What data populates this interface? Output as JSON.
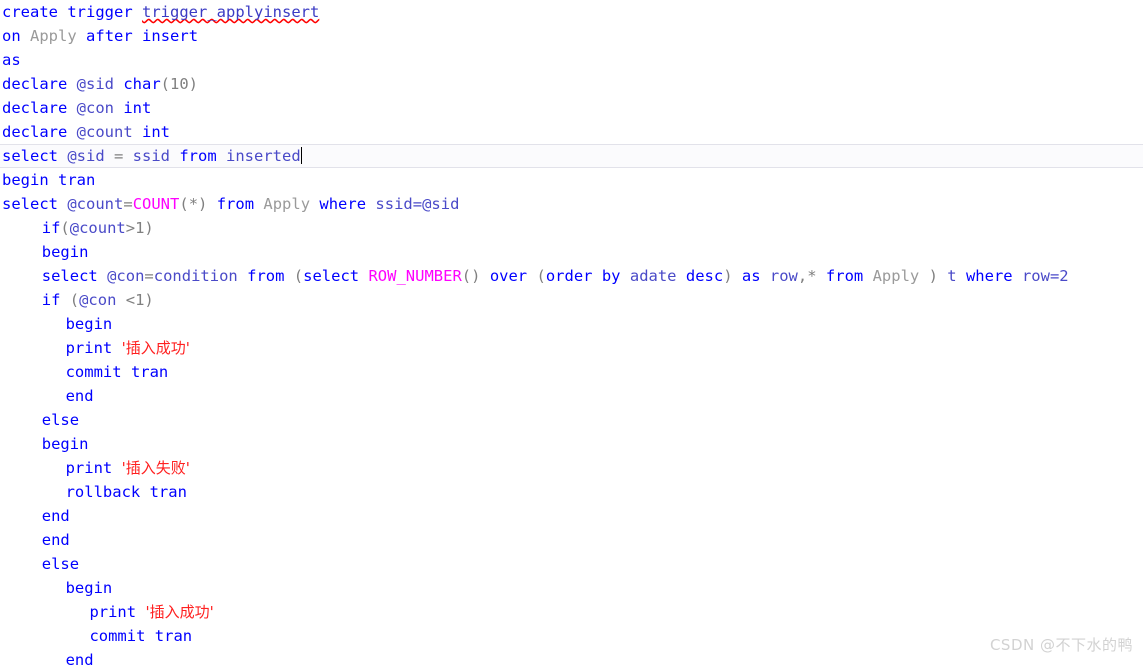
{
  "editor": {
    "language": "sql",
    "cursor_line_index": 7,
    "colors": {
      "background": "#ffffff",
      "keyword": "#0000ff",
      "function": "#ff00ff",
      "identifier": "#9a9a9a",
      "string": "#ff2020",
      "variable": "#4a4ac8",
      "current_line_border": "#e2e2ea",
      "spellcheck_underline": "#ff0000",
      "watermark": "#d2d2d2"
    },
    "lines": [
      {
        "indent": 0,
        "current": false,
        "tokens": [
          {
            "t": "create",
            "c": "kw"
          },
          {
            "t": " ",
            "c": "pl"
          },
          {
            "t": "trigger",
            "c": "kw"
          },
          {
            "t": " ",
            "c": "pl"
          },
          {
            "t": "trigger_applyinsert",
            "c": "squiggle"
          }
        ]
      },
      {
        "indent": 0,
        "current": false,
        "tokens": [
          {
            "t": "on",
            "c": "kw"
          },
          {
            "t": " ",
            "c": "pl"
          },
          {
            "t": "Apply",
            "c": "id"
          },
          {
            "t": " ",
            "c": "pl"
          },
          {
            "t": "after",
            "c": "kw"
          },
          {
            "t": " ",
            "c": "pl"
          },
          {
            "t": "insert",
            "c": "kw"
          }
        ]
      },
      {
        "indent": 0,
        "current": false,
        "tokens": [
          {
            "t": "as",
            "c": "kw"
          }
        ]
      },
      {
        "indent": 0,
        "current": false,
        "tokens": [
          {
            "t": "declare",
            "c": "kw"
          },
          {
            "t": " ",
            "c": "pl"
          },
          {
            "t": "@sid",
            "c": "var"
          },
          {
            "t": " ",
            "c": "pl"
          },
          {
            "t": "char",
            "c": "kw"
          },
          {
            "t": "(10)",
            "c": "pl"
          }
        ]
      },
      {
        "indent": 0,
        "current": false,
        "tokens": [
          {
            "t": "declare",
            "c": "kw"
          },
          {
            "t": " ",
            "c": "pl"
          },
          {
            "t": "@con",
            "c": "var"
          },
          {
            "t": " ",
            "c": "pl"
          },
          {
            "t": "int",
            "c": "kw"
          }
        ]
      },
      {
        "indent": 0,
        "current": false,
        "tokens": [
          {
            "t": "declare",
            "c": "kw"
          },
          {
            "t": " ",
            "c": "pl"
          },
          {
            "t": "@count",
            "c": "var"
          },
          {
            "t": " ",
            "c": "pl"
          },
          {
            "t": "int",
            "c": "kw"
          }
        ]
      },
      {
        "indent": 0,
        "current": true,
        "caret": true,
        "tokens": [
          {
            "t": "select",
            "c": "kw"
          },
          {
            "t": " ",
            "c": "pl"
          },
          {
            "t": "@sid",
            "c": "var"
          },
          {
            "t": " = ",
            "c": "pl"
          },
          {
            "t": "ssid",
            "c": "var"
          },
          {
            "t": " ",
            "c": "pl"
          },
          {
            "t": "from",
            "c": "kw"
          },
          {
            "t": " ",
            "c": "pl"
          },
          {
            "t": "inserted",
            "c": "var"
          }
        ]
      },
      {
        "indent": 0,
        "current": false,
        "tokens": [
          {
            "t": "begin",
            "c": "kw"
          },
          {
            "t": " ",
            "c": "pl"
          },
          {
            "t": "tran",
            "c": "kw"
          }
        ]
      },
      {
        "indent": 0,
        "current": false,
        "tokens": [
          {
            "t": "select",
            "c": "kw"
          },
          {
            "t": " ",
            "c": "pl"
          },
          {
            "t": "@count",
            "c": "var"
          },
          {
            "t": "=",
            "c": "pl"
          },
          {
            "t": "COUNT",
            "c": "fn"
          },
          {
            "t": "(*)",
            "c": "pl"
          },
          {
            "t": " ",
            "c": "pl"
          },
          {
            "t": "from",
            "c": "kw"
          },
          {
            "t": " ",
            "c": "pl"
          },
          {
            "t": "Apply",
            "c": "id"
          },
          {
            "t": " ",
            "c": "pl"
          },
          {
            "t": "where",
            "c": "kw"
          },
          {
            "t": " ",
            "c": "pl"
          },
          {
            "t": "ssid=",
            "c": "var"
          },
          {
            "t": "@sid",
            "c": "var"
          }
        ]
      },
      {
        "indent": 5,
        "current": false,
        "tokens": [
          {
            "t": "if",
            "c": "kw"
          },
          {
            "t": "(",
            "c": "pl"
          },
          {
            "t": "@count",
            "c": "var"
          },
          {
            "t": ">1)",
            "c": "pl"
          }
        ]
      },
      {
        "indent": 5,
        "current": false,
        "tokens": [
          {
            "t": "begin",
            "c": "kw"
          }
        ]
      },
      {
        "indent": 5,
        "current": false,
        "tokens": [
          {
            "t": "select",
            "c": "kw"
          },
          {
            "t": " ",
            "c": "pl"
          },
          {
            "t": "@con",
            "c": "var"
          },
          {
            "t": "=",
            "c": "pl"
          },
          {
            "t": "condition",
            "c": "var"
          },
          {
            "t": " ",
            "c": "pl"
          },
          {
            "t": "from",
            "c": "kw"
          },
          {
            "t": " ",
            "c": "pl"
          },
          {
            "t": "(",
            "c": "pl"
          },
          {
            "t": "select",
            "c": "kw"
          },
          {
            "t": " ",
            "c": "pl"
          },
          {
            "t": "ROW_NUMBER",
            "c": "fn"
          },
          {
            "t": "()",
            "c": "pl"
          },
          {
            "t": " ",
            "c": "pl"
          },
          {
            "t": "over",
            "c": "kw"
          },
          {
            "t": " ",
            "c": "pl"
          },
          {
            "t": "(",
            "c": "pl"
          },
          {
            "t": "order",
            "c": "kw"
          },
          {
            "t": " ",
            "c": "pl"
          },
          {
            "t": "by",
            "c": "kw"
          },
          {
            "t": " ",
            "c": "pl"
          },
          {
            "t": "adate",
            "c": "var"
          },
          {
            "t": " ",
            "c": "pl"
          },
          {
            "t": "desc",
            "c": "kw"
          },
          {
            "t": ") ",
            "c": "pl"
          },
          {
            "t": "as",
            "c": "kw"
          },
          {
            "t": " ",
            "c": "pl"
          },
          {
            "t": "row",
            "c": "var"
          },
          {
            "t": ",",
            "c": "pl"
          },
          {
            "t": "*",
            "c": "pl"
          },
          {
            "t": " ",
            "c": "pl"
          },
          {
            "t": "from",
            "c": "kw"
          },
          {
            "t": " ",
            "c": "pl"
          },
          {
            "t": "Apply",
            "c": "id"
          },
          {
            "t": " ) ",
            "c": "pl"
          },
          {
            "t": "t",
            "c": "var"
          },
          {
            "t": " ",
            "c": "pl"
          },
          {
            "t": "where",
            "c": "kw"
          },
          {
            "t": " ",
            "c": "pl"
          },
          {
            "t": "row=2",
            "c": "var"
          }
        ]
      },
      {
        "indent": 5,
        "current": false,
        "tokens": [
          {
            "t": "if",
            "c": "kw"
          },
          {
            "t": " (",
            "c": "pl"
          },
          {
            "t": "@con",
            "c": "var"
          },
          {
            "t": " <1)",
            "c": "pl"
          }
        ]
      },
      {
        "indent": 8,
        "current": false,
        "tokens": [
          {
            "t": "begin",
            "c": "kw"
          }
        ]
      },
      {
        "indent": 8,
        "current": false,
        "tokens": [
          {
            "t": "print",
            "c": "kw"
          },
          {
            "t": " ",
            "c": "pl"
          },
          {
            "t": "'插入成功'",
            "c": "str cjk"
          }
        ]
      },
      {
        "indent": 8,
        "current": false,
        "tokens": [
          {
            "t": "commit",
            "c": "kw"
          },
          {
            "t": " ",
            "c": "pl"
          },
          {
            "t": "tran",
            "c": "kw"
          }
        ]
      },
      {
        "indent": 8,
        "current": false,
        "tokens": [
          {
            "t": "end",
            "c": "kw"
          }
        ]
      },
      {
        "indent": 5,
        "current": false,
        "tokens": [
          {
            "t": "else",
            "c": "kw"
          }
        ]
      },
      {
        "indent": 5,
        "current": false,
        "tokens": [
          {
            "t": "begin",
            "c": "kw"
          }
        ]
      },
      {
        "indent": 8,
        "current": false,
        "tokens": [
          {
            "t": "print",
            "c": "kw"
          },
          {
            "t": " ",
            "c": "pl"
          },
          {
            "t": "'插入失败'",
            "c": "str cjk"
          }
        ]
      },
      {
        "indent": 8,
        "current": false,
        "tokens": [
          {
            "t": "rollback",
            "c": "kw"
          },
          {
            "t": " ",
            "c": "pl"
          },
          {
            "t": "tran",
            "c": "kw"
          }
        ]
      },
      {
        "indent": 5,
        "current": false,
        "tokens": [
          {
            "t": "end",
            "c": "kw"
          }
        ]
      },
      {
        "indent": 5,
        "current": false,
        "tokens": [
          {
            "t": "end",
            "c": "kw"
          }
        ]
      },
      {
        "indent": 5,
        "current": false,
        "tokens": [
          {
            "t": "else",
            "c": "kw"
          }
        ]
      },
      {
        "indent": 8,
        "current": false,
        "tokens": [
          {
            "t": "begin",
            "c": "kw"
          }
        ]
      },
      {
        "indent": 11,
        "current": false,
        "tokens": [
          {
            "t": "print",
            "c": "kw"
          },
          {
            "t": " ",
            "c": "pl"
          },
          {
            "t": "'插入成功'",
            "c": "str cjk"
          }
        ]
      },
      {
        "indent": 11,
        "current": false,
        "tokens": [
          {
            "t": "commit",
            "c": "kw"
          },
          {
            "t": " ",
            "c": "pl"
          },
          {
            "t": "tran",
            "c": "kw"
          }
        ]
      },
      {
        "indent": 8,
        "current": false,
        "tokens": [
          {
            "t": "end",
            "c": "kw"
          }
        ]
      }
    ]
  },
  "watermark": {
    "text": "CSDN @不下水的鸭"
  }
}
